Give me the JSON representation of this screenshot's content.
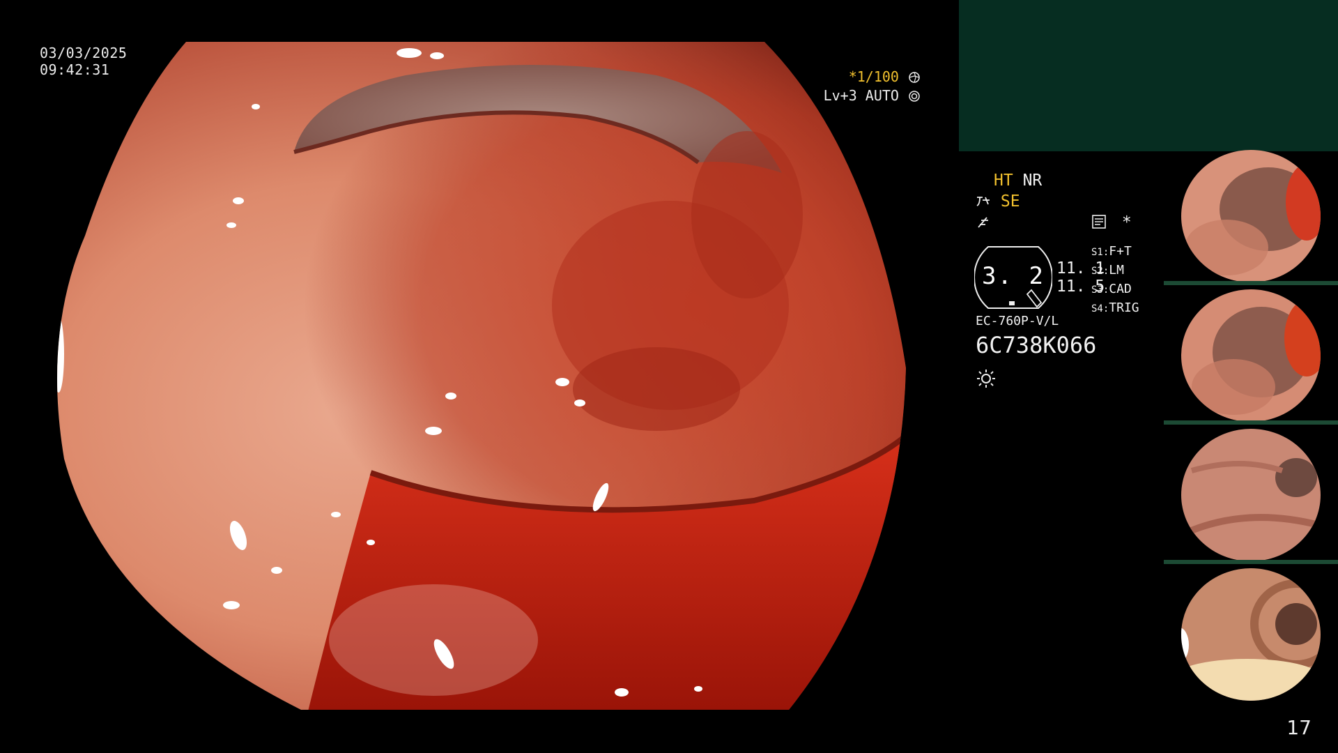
{
  "datetime": {
    "date": "03/03/2025",
    "time": "09:42:31"
  },
  "overlay": {
    "shutter": "*1/100",
    "shutter_icon": "aperture-icon",
    "level_mode": "Lv+3 AUTO",
    "mode_icon": "target-icon"
  },
  "settings": {
    "ht": "HT",
    "nr": "NR",
    "se": "SE",
    "se_icon": "magnify-icon",
    "f_icon": "f-mode-icon",
    "memo_icon": "memo-icon",
    "star": "*",
    "level_value": "3. 2",
    "val_top": "11. 1",
    "val_bottom": "11. 5",
    "switches": [
      {
        "key": "S1:",
        "value": "F+T"
      },
      {
        "key": "S2:",
        "value": "LM"
      },
      {
        "key": "S3:",
        "value": "CAD"
      },
      {
        "key": "S4:",
        "value": "TRIG"
      }
    ],
    "scope_model": "EC-760P-V/L",
    "serial": "6C738K066",
    "light_icon": "light-icon"
  },
  "thumbnails": [
    {
      "label": "captured-image-1"
    },
    {
      "label": "captured-image-2"
    },
    {
      "label": "captured-image-3"
    },
    {
      "label": "captured-image-4"
    }
  ],
  "page_number": "17",
  "colors": {
    "accent_yellow": "#f2c12e",
    "panel_green": "#062d21",
    "background": "#000000"
  }
}
